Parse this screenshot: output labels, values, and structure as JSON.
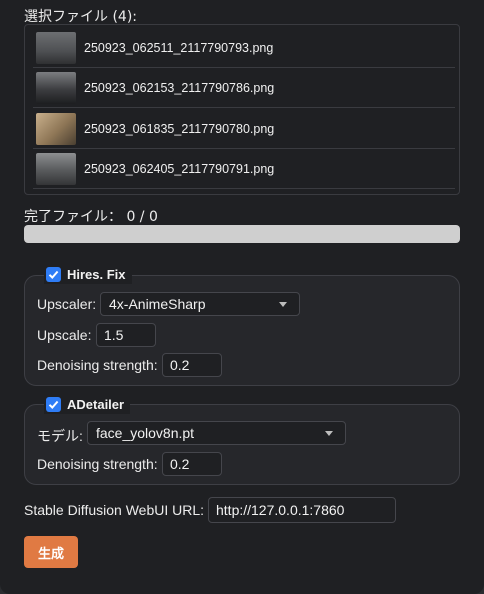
{
  "files": {
    "label": "選択ファイル (4):",
    "items": [
      {
        "name": "250923_062511_2117790793.png"
      },
      {
        "name": "250923_062153_2117790786.png"
      },
      {
        "name": "250923_061835_2117790780.png"
      },
      {
        "name": "250923_062405_2117790791.png"
      }
    ]
  },
  "progress": {
    "label": "完了ファイル： 0 / 0",
    "value": 0
  },
  "hires": {
    "title": "Hires. Fix",
    "enabled": true,
    "upscaler_label": "Upscaler:",
    "upscaler_value": "4x-AnimeSharp",
    "upscale_label": "Upscale:",
    "upscale_value": "1.5",
    "denoise_label": "Denoising strength:",
    "denoise_value": "0.2"
  },
  "adetailer": {
    "title": "ADetailer",
    "enabled": true,
    "model_label": "モデル:",
    "model_value": "face_yolov8n.pt",
    "denoise_label": "Denoising strength:",
    "denoise_value": "0.2"
  },
  "webui": {
    "url_label": "Stable Diffusion WebUI URL:",
    "url_value": "http://127.0.0.1:7860"
  },
  "actions": {
    "generate_label": "生成"
  },
  "colors": {
    "accent_button": "#e07a43",
    "checkbox": "#2f7df6",
    "progress_track": "#cfcfcf"
  }
}
